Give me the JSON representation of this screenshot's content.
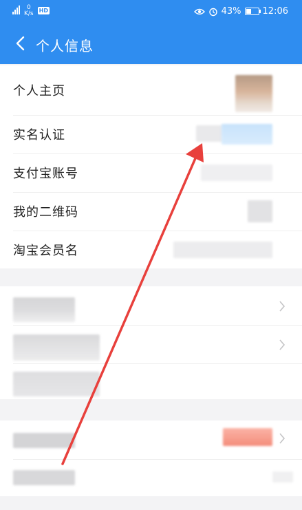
{
  "status_bar": {
    "network_speed_value": "0",
    "network_speed_unit": "K/s",
    "hd_badge": "HD",
    "battery": "43%",
    "battery_level": 0.43,
    "time": "12:06"
  },
  "nav": {
    "title": "个人信息"
  },
  "profile_rows": [
    {
      "label": "个人主页"
    },
    {
      "label": "实名认证"
    },
    {
      "label": "支付宝账号"
    },
    {
      "label": "我的二维码"
    },
    {
      "label": "淘宝会员名"
    }
  ],
  "colors": {
    "header_blue": "#2f8df0",
    "annotation_arrow": "#e8403c"
  },
  "icons": {
    "back": "chevron-left-icon",
    "row_chevron": "chevron-right-icon"
  }
}
